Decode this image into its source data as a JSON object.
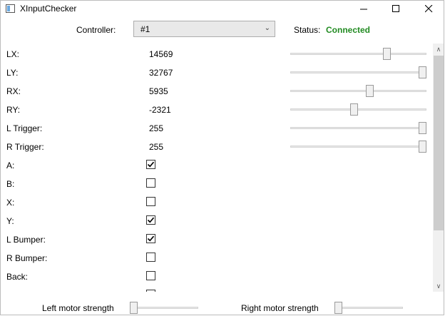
{
  "window": {
    "title": "XInputChecker"
  },
  "header": {
    "controller_label": "Controller:",
    "controller_value": "#1",
    "status_label": "Status:",
    "status_value": "Connected",
    "status_color": "#228b22"
  },
  "axes": [
    {
      "label": "LX:",
      "value": "14569",
      "level": 0.722
    },
    {
      "label": "LY:",
      "value": "32767",
      "level": 1.0
    },
    {
      "label": "RX:",
      "value": "5935",
      "level": 0.591
    },
    {
      "label": "RY:",
      "value": "-2321",
      "level": 0.465
    },
    {
      "label": "L Trigger:",
      "value": "255",
      "level": 1.0
    },
    {
      "label": "R Trigger:",
      "value": "255",
      "level": 1.0
    }
  ],
  "buttons": [
    {
      "label": "A:",
      "checked": true
    },
    {
      "label": "B:",
      "checked": false
    },
    {
      "label": "X:",
      "checked": false
    },
    {
      "label": "Y:",
      "checked": true
    },
    {
      "label": "L Bumper:",
      "checked": true
    },
    {
      "label": "R Bumper:",
      "checked": false
    },
    {
      "label": "Back:",
      "checked": false
    },
    {
      "label": "",
      "checked": false
    }
  ],
  "motors": {
    "left_label": "Left motor strength",
    "left_level": 0,
    "right_label": "Right motor strength",
    "right_level": 0
  },
  "icons": [
    "app-icon",
    "minimize-icon",
    "maximize-icon",
    "close-icon",
    "chevron-down-icon",
    "scroll-up-arrow-icon",
    "scroll-down-arrow-icon",
    "checkmark-icon"
  ]
}
